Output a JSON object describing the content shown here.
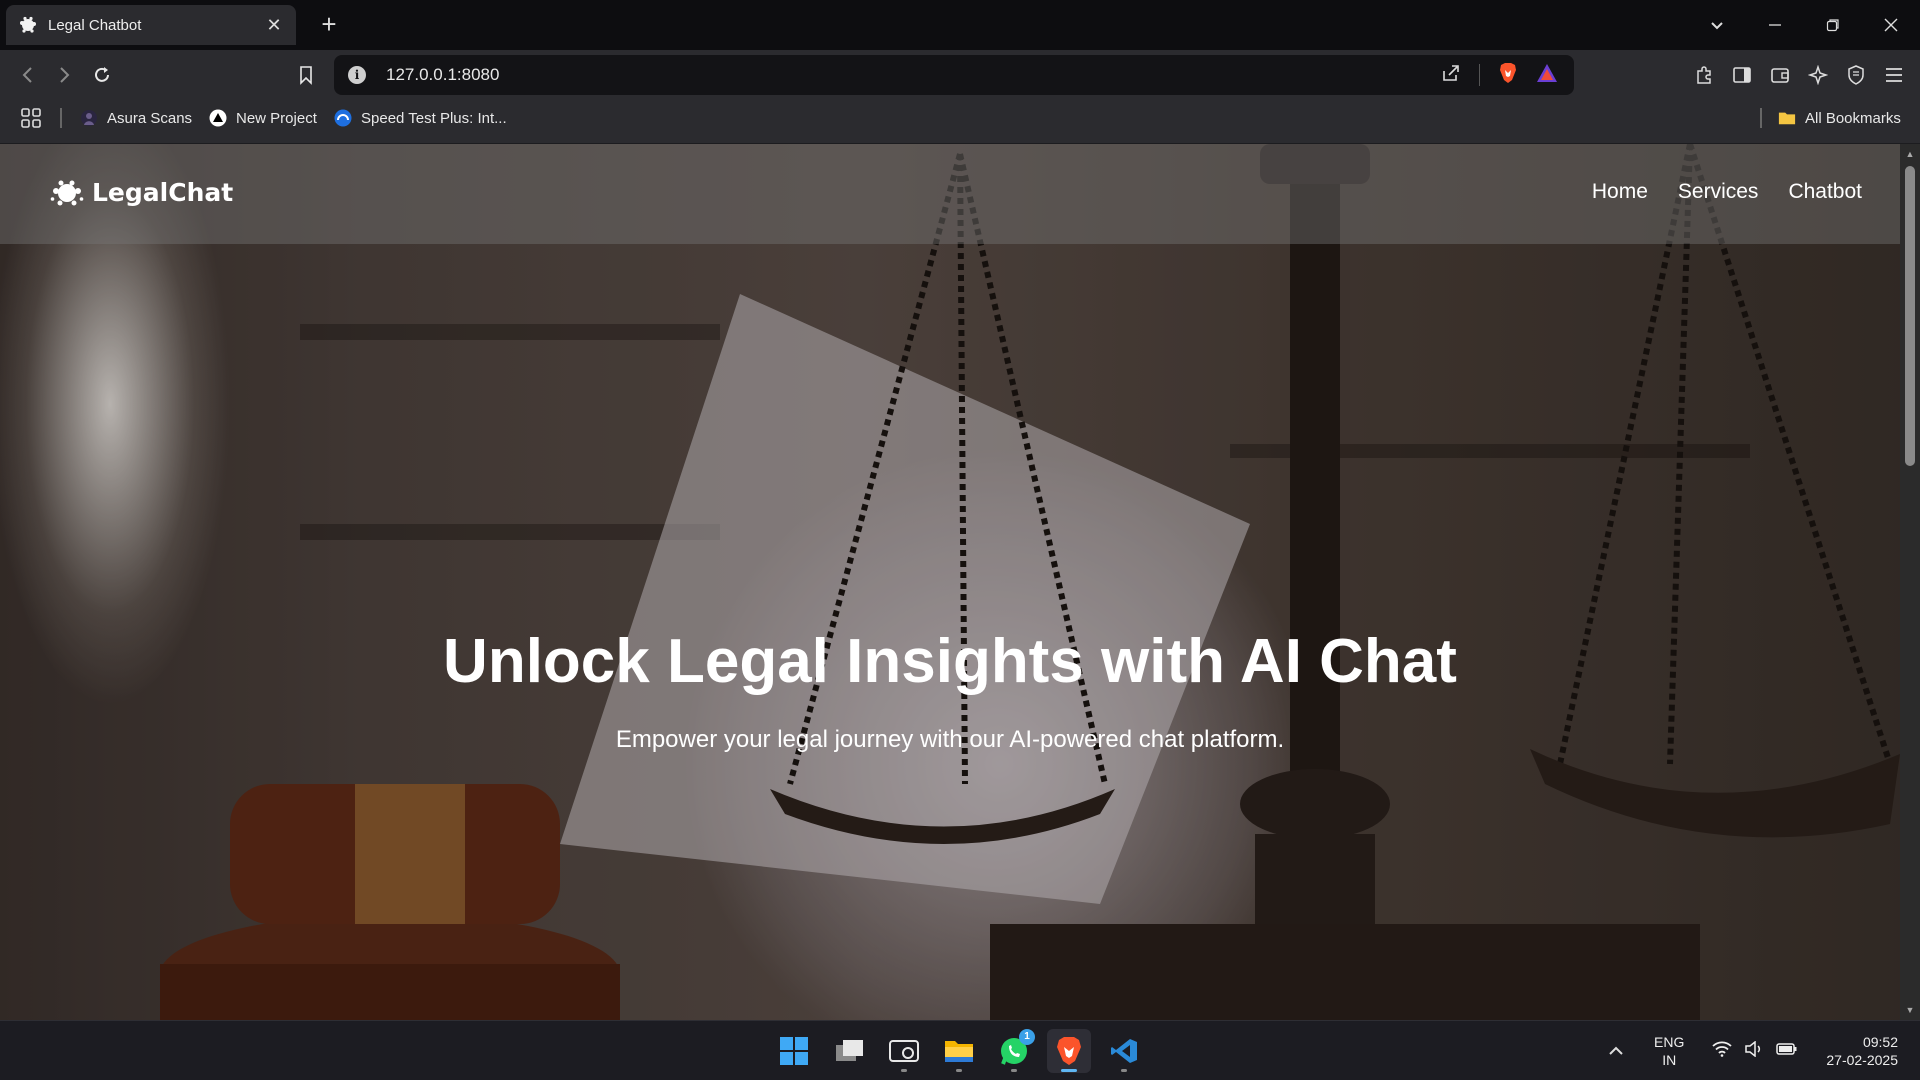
{
  "browser": {
    "tab_title": "Legal Chatbot",
    "tab_close": "✕",
    "new_tab": "+",
    "url": "127.0.0.1:8080",
    "bookmarks": [
      {
        "label": "Asura Scans"
      },
      {
        "label": "New Project"
      },
      {
        "label": "Speed Test Plus: Int..."
      }
    ],
    "all_bookmarks": "All Bookmarks"
  },
  "site": {
    "brand": "LegalChat",
    "nav": [
      "Home",
      "Services",
      "Chatbot"
    ],
    "hero_title": "Unlock Legal Insights with AI Chat",
    "hero_subtitle": "Empower your legal journey with our AI-powered chat platform."
  },
  "taskbar": {
    "apps": [
      "start-icon",
      "task-view-icon",
      "screen-capture-icon",
      "file-explorer-icon",
      "whatsapp-icon",
      "brave-icon",
      "vscode-icon"
    ],
    "whatsapp_badge": "1",
    "language_line1": "ENG",
    "language_line2": "IN",
    "time": "09:52",
    "date": "27-02-2025"
  },
  "colors": {
    "chrome_dark": "#0d0d10",
    "chrome": "#2b2b2f",
    "brave_orange": "#fb542b",
    "taskbar": "#1c1c22",
    "accent_blue": "#5fb6f2"
  }
}
